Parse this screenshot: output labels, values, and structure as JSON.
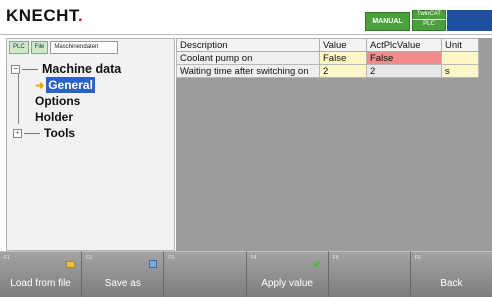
{
  "header": {
    "logo_text": "KNECHT",
    "logo_dot": ".",
    "mode": "MANUAL",
    "twincat_label": "TwinCAT",
    "plc_label": "PLC"
  },
  "left_panel": {
    "chips": [
      "PLC",
      "File",
      "Maschinendaten"
    ],
    "tree": {
      "root": "Machine data",
      "children": [
        "General",
        "Options",
        "Holder",
        "Tools"
      ],
      "selected": "General"
    }
  },
  "table": {
    "headers": [
      "Description",
      "Value",
      "ActPlcValue",
      "Unit"
    ],
    "rows": [
      {
        "description": "Coolant pump on",
        "value": "False",
        "act": "False",
        "unit": ""
      },
      {
        "description": "Waiting time after switching on",
        "value": "2",
        "act": "2",
        "unit": "s"
      }
    ]
  },
  "fkeys": [
    {
      "num": "F1",
      "label": "Load  from file",
      "icon": "folder-icon"
    },
    {
      "num": "F2",
      "label": "Save as",
      "icon": "disk-icon"
    },
    {
      "num": "F3",
      "label": "",
      "icon": ""
    },
    {
      "num": "F4",
      "label": "Apply value",
      "icon": "check-icon"
    },
    {
      "num": "F5",
      "label": "",
      "icon": ""
    },
    {
      "num": "F6",
      "label": "Back",
      "icon": ""
    }
  ],
  "colors": {
    "mode_badge": "#4aa03a",
    "selection": "#2b62c6",
    "value_cell": "#fff7c8",
    "act_mismatch": "#f08c8c"
  }
}
